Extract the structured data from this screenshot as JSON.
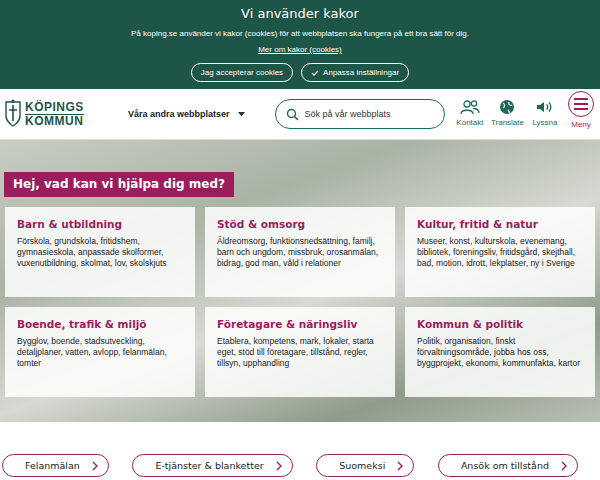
{
  "cookie_banner": {
    "title": "Vi använder kakor",
    "text": "På koping.se använder vi kakor (cookies) för att webbplatsen ska fungera på ett bra sätt för dig.",
    "link": "Mer om kakor (cookies)",
    "buttons": [
      {
        "label": "Jag accepterar cookies",
        "kind": "plain"
      },
      {
        "label": "Anpassa inställningar",
        "kind": "check"
      }
    ]
  },
  "header": {
    "logo": [
      "KÖPINGS",
      "KOMMUN"
    ],
    "other_sites": "Våra andra webbplatser",
    "search": {
      "placeholder": "Sök på vår webbplats"
    },
    "tools": [
      {
        "label": "Kontakt",
        "kind": "people"
      },
      {
        "label": "Translate",
        "kind": "globe"
      },
      {
        "label": "Lyssna",
        "kind": "speaker"
      },
      {
        "label": "Meny",
        "kind": "menu"
      }
    ]
  },
  "hero": {
    "heading": "Hej, vad kan vi hjälpa dig med?",
    "cards": [
      {
        "title": "Barn & utbildning",
        "description": "Förskola, grundskola, fritidshem, gymnasieskola, anpassade skolformer, vuxenutbildning, skolmat, lov, skolskjuts"
      },
      {
        "title": "Stöd & omsorg",
        "description": "Äldreomsorg, funktionsnedsättning, familj, barn och ungdom, missbruk, orosanmälan, bidrag, god man, våld i relationer"
      },
      {
        "title": "Kultur, fritid & natur",
        "description": "Museer, konst, kulturskola, evenemang, bibliotek, föreningsliv, fritidsgård, skejthall, bad, motion, idrott, lekplatser, ny i Sverige"
      },
      {
        "title": "Boende, trafik & miljö",
        "description": "Bygglov, boende, stadsutveckling, detaljplaner, vatten, avlopp, felanmälan, tomter"
      },
      {
        "title": "Företagare & näringsliv",
        "description": "Etablera, kompetens, mark, lokaler, starta eget, stöd till företagare, tillstånd, regler, tillsyn, upphandling"
      },
      {
        "title": "Kommun & politik",
        "description": "Politik, organisation, finskt förvaltningsområde, jobba hos oss, byggprojekt, ekonomi, kommunfakta, kartor"
      }
    ]
  },
  "quick_links": [
    {
      "label": "Felanmälan"
    },
    {
      "label": "E-tjänster & blanketter"
    },
    {
      "label": "Suomeksi"
    },
    {
      "label": "Ansök om tillstånd"
    }
  ]
}
